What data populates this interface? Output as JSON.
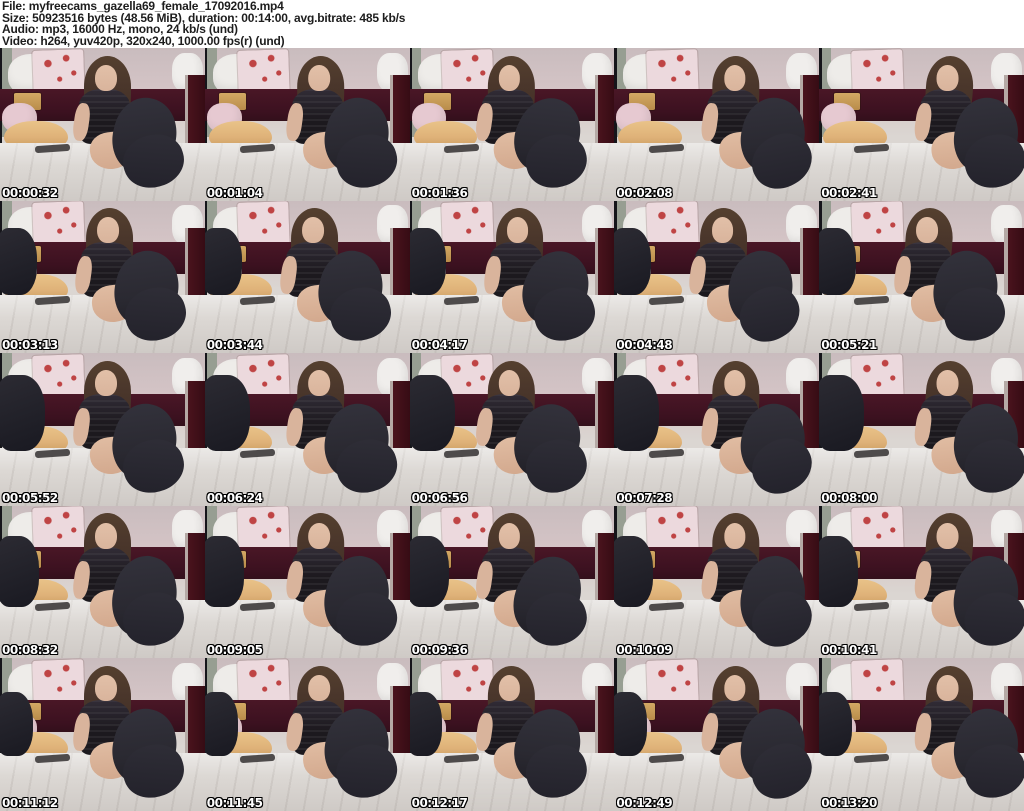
{
  "header": {
    "lines": [
      "File: myfreecams_gazella69_female_17092016.mp4",
      "Size: 50923516 bytes (48.56 MiB), duration: 00:14:00, avg.bitrate: 485 kb/s",
      "Audio: mp3, 16000 Hz, mono, 24 kb/s (und)",
      "Video: h264, yuv420p, 320x240, 1000.00 fps(r) (und)"
    ]
  },
  "grid": {
    "rows": 5,
    "columns": 5
  },
  "thumbnails": [
    {
      "timestamp": "00:00:32"
    },
    {
      "timestamp": "00:01:04"
    },
    {
      "timestamp": "00:01:36"
    },
    {
      "timestamp": "00:02:08"
    },
    {
      "timestamp": "00:02:41"
    },
    {
      "timestamp": "00:03:13"
    },
    {
      "timestamp": "00:03:44"
    },
    {
      "timestamp": "00:04:17"
    },
    {
      "timestamp": "00:04:48"
    },
    {
      "timestamp": "00:05:21"
    },
    {
      "timestamp": "00:05:52"
    },
    {
      "timestamp": "00:06:24"
    },
    {
      "timestamp": "00:06:56"
    },
    {
      "timestamp": "00:07:28"
    },
    {
      "timestamp": "00:08:00"
    },
    {
      "timestamp": "00:08:32"
    },
    {
      "timestamp": "00:09:05"
    },
    {
      "timestamp": "00:09:36"
    },
    {
      "timestamp": "00:10:09"
    },
    {
      "timestamp": "00:10:41"
    },
    {
      "timestamp": "00:11:12"
    },
    {
      "timestamp": "00:11:45"
    },
    {
      "timestamp": "00:12:17"
    },
    {
      "timestamp": "00:12:49"
    },
    {
      "timestamp": "00:13:20"
    }
  ],
  "palette": {
    "page_background": "#ffffff",
    "header_text": "#1d1d1d",
    "timestamp_text": "#ffffff",
    "timestamp_outline": "#000000",
    "scene": {
      "wall_pink": "#d2c2c4",
      "wall_edge_gray": "#979e92",
      "pillow_white": "#eeece9",
      "pillow_pink": "#e6c9d1",
      "board_pink": "#ecd9dd",
      "heart_red": "#bf4444",
      "headboard_maroon": "#3c1120",
      "curtain_maroon": "#4a131d",
      "cushion_tan": "#dfb279",
      "bed_white": "#dcd8d4",
      "hair_brown": "#4a362b",
      "skin": "#d9b49c",
      "top_dark": "#1c191e",
      "stocking_dark": "#2a2931"
    }
  }
}
